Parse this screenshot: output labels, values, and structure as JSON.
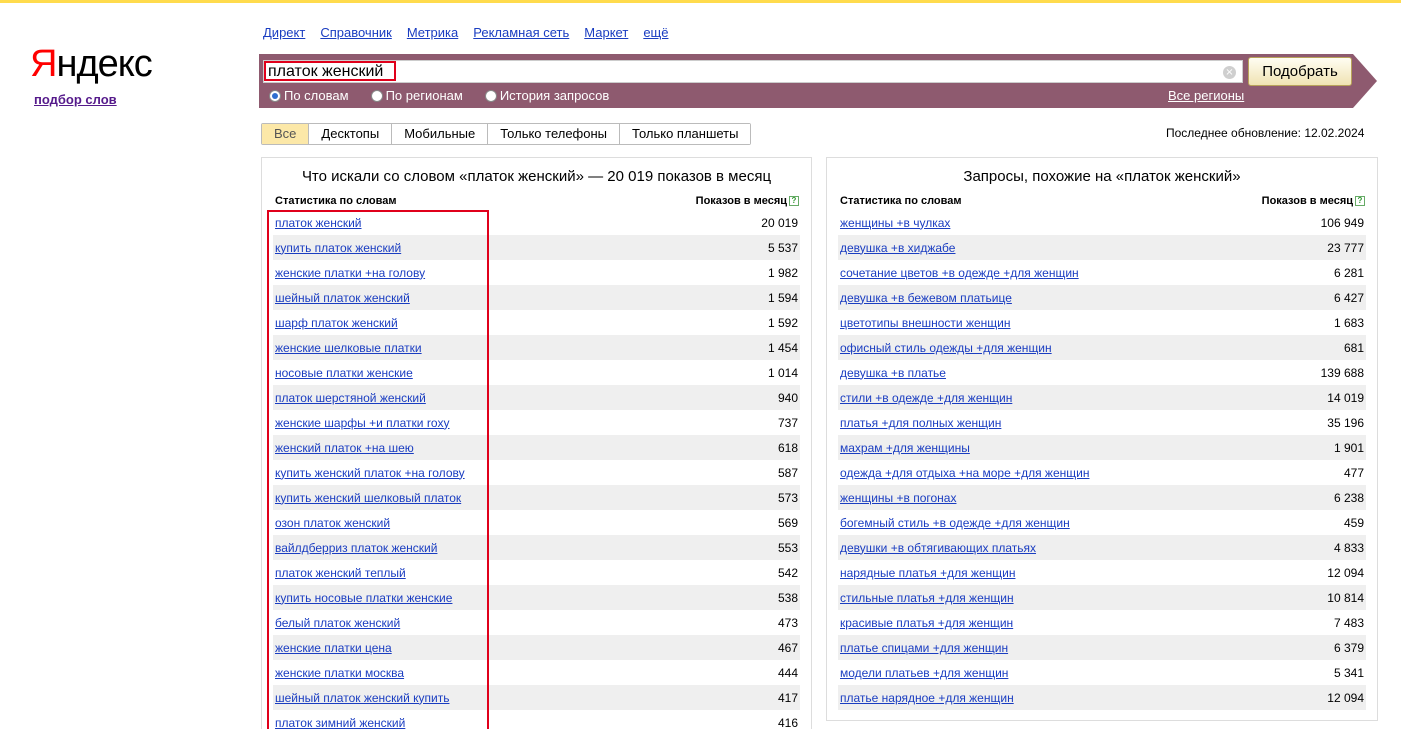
{
  "logo": {
    "first_letter": "Я",
    "rest": "ндекс",
    "subtitle": "подбор слов"
  },
  "services": [
    "Директ",
    "Справочник",
    "Метрика",
    "Рекламная сеть",
    "Маркет",
    "ещё"
  ],
  "search": {
    "value": "платок женский",
    "button": "Подобрать",
    "clear_icon": "×"
  },
  "modes": [
    {
      "label": "По словам",
      "checked": true
    },
    {
      "label": "По регионам",
      "checked": false
    },
    {
      "label": "История запросов",
      "checked": false
    }
  ],
  "regions_link": "Все регионы",
  "tabs": [
    {
      "label": "Все",
      "active": true
    },
    {
      "label": "Десктопы",
      "active": false
    },
    {
      "label": "Мобильные",
      "active": false
    },
    {
      "label": "Только телефоны",
      "active": false
    },
    {
      "label": "Только планшеты",
      "active": false
    }
  ],
  "last_update": "Последнее обновление: 12.02.2024",
  "left_panel": {
    "title": "Что искали со словом «платок женский» — 20 019 показов в месяц",
    "col_words": "Статистика по словам",
    "col_shows": "Показов в месяц",
    "help_icon": "?",
    "rows": [
      {
        "query": "платок женский",
        "count": "20 019"
      },
      {
        "query": "купить платок женский",
        "count": "5 537"
      },
      {
        "query": "женские платки +на голову",
        "count": "1 982"
      },
      {
        "query": "шейный платок женский",
        "count": "1 594"
      },
      {
        "query": "шарф платок женский",
        "count": "1 592"
      },
      {
        "query": "женские шелковые платки",
        "count": "1 454"
      },
      {
        "query": "носовые платки женские",
        "count": "1 014"
      },
      {
        "query": "платок шерстяной женский",
        "count": "940"
      },
      {
        "query": "женские шарфы +и платки roxy",
        "count": "737"
      },
      {
        "query": "женский платок +на шею",
        "count": "618"
      },
      {
        "query": "купить женский платок +на голову",
        "count": "587"
      },
      {
        "query": "купить женский шелковый платок",
        "count": "573"
      },
      {
        "query": "озон платок женский",
        "count": "569"
      },
      {
        "query": "вайлдберриз платок женский",
        "count": "553"
      },
      {
        "query": "платок женский теплый",
        "count": "542"
      },
      {
        "query": "купить носовые платки женские",
        "count": "538"
      },
      {
        "query": "белый платок женский",
        "count": "473"
      },
      {
        "query": "женские платки цена",
        "count": "467"
      },
      {
        "query": "женские платки москва",
        "count": "444"
      },
      {
        "query": "шейный платок женский купить",
        "count": "417"
      },
      {
        "query": "платок зимний женский",
        "count": "416"
      }
    ]
  },
  "right_panel": {
    "title": "Запросы, похожие на «платок женский»",
    "col_words": "Статистика по словам",
    "col_shows": "Показов в месяц",
    "help_icon": "?",
    "rows": [
      {
        "query": "женщины +в чулках",
        "count": "106 949"
      },
      {
        "query": "девушка +в хиджабе",
        "count": "23 777"
      },
      {
        "query": "сочетание цветов +в одежде +для женщин",
        "count": "6 281"
      },
      {
        "query": "девушка +в бежевом платьице",
        "count": "6 427"
      },
      {
        "query": "цветотипы внешности женщин",
        "count": "1 683"
      },
      {
        "query": "офисный стиль одежды +для женщин",
        "count": "681"
      },
      {
        "query": "девушка +в платье",
        "count": "139 688"
      },
      {
        "query": "стили +в одежде +для женщин",
        "count": "14 019"
      },
      {
        "query": "платья +для полных женщин",
        "count": "35 196"
      },
      {
        "query": "махрам +для женщины",
        "count": "1 901"
      },
      {
        "query": "одежда +для отдыха +на море +для женщин",
        "count": "477"
      },
      {
        "query": "женщины +в погонах",
        "count": "6 238"
      },
      {
        "query": "богемный стиль +в одежде +для женщин",
        "count": "459"
      },
      {
        "query": "девушки +в обтягивающих платьях",
        "count": "4 833"
      },
      {
        "query": "нарядные платья +для женщин",
        "count": "12 094"
      },
      {
        "query": "стильные платья +для женщин",
        "count": "10 814"
      },
      {
        "query": "красивые платья +для женщин",
        "count": "7 483"
      },
      {
        "query": "платье спицами +для женщин",
        "count": "6 379"
      },
      {
        "query": "модели платьев +для женщин",
        "count": "5 341"
      },
      {
        "query": "платье нарядное +для женщин",
        "count": "12 094"
      }
    ]
  },
  "colors": {
    "band": "#8e5a6f",
    "highlight": "#e0001b",
    "link": "#1a3dc1",
    "active_tab": "#fce8a8"
  }
}
